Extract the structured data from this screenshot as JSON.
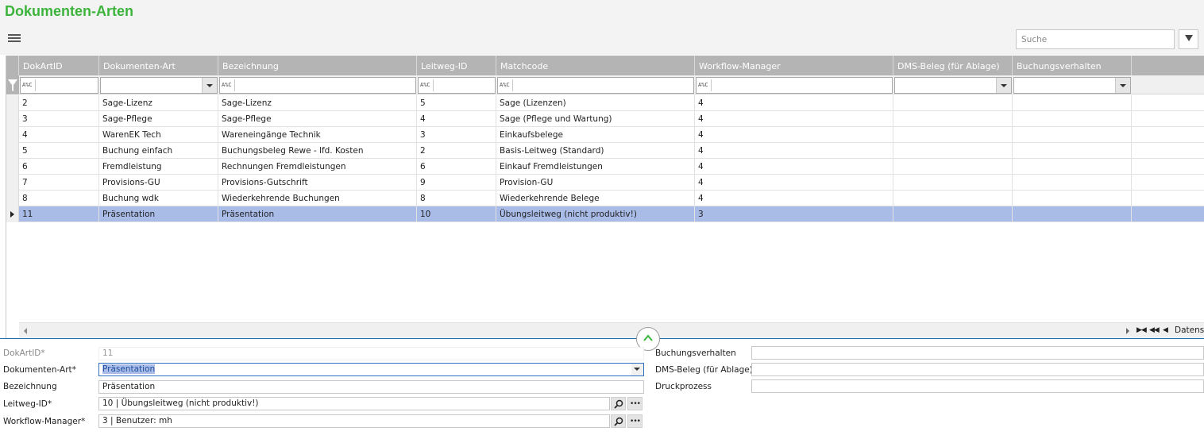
{
  "app": {
    "title": "Dokumenten-Arten"
  },
  "toolbar": {
    "search_placeholder": "Suche",
    "filter_toggle_icon": "triangle-down-icon"
  },
  "grid": {
    "columns": [
      "DokArtID",
      "Dokumenten-Art",
      "Bezeichnung",
      "Leitweg-ID",
      "Matchcode",
      "Workflow-Manager",
      "DMS-Beleg (für Ablage)",
      "Buchungsverhalten"
    ],
    "filter_operator_glyph": "A%C",
    "rows": [
      [
        "2",
        "Sage-Lizenz",
        "Sage-Lizenz",
        "5",
        "Sage (Lizenzen)",
        "4",
        "",
        ""
      ],
      [
        "3",
        "Sage-Pflege",
        "Sage-Pflege",
        "4",
        "Sage (Pflege und Wartung)",
        "4",
        "",
        ""
      ],
      [
        "4",
        "WarenEK Tech",
        "Wareneingänge Technik",
        "3",
        "Einkaufsbelege",
        "4",
        "",
        ""
      ],
      [
        "5",
        "Buchung einfach",
        "Buchungsbeleg Rewe - lfd. Kosten",
        "2",
        "Basis-Leitweg (Standard)",
        "4",
        "",
        ""
      ],
      [
        "6",
        "Fremdleistung",
        "Rechnungen Fremdleistungen",
        "6",
        "Einkauf Fremdleistungen",
        "4",
        "",
        ""
      ],
      [
        "7",
        "Provisions-GU",
        "Provisions-Gutschrift",
        "9",
        "Provision-GU",
        "4",
        "",
        ""
      ],
      [
        "8",
        "Buchung wdk",
        "Wiederkehrende Buchungen",
        "8",
        "Wiederkehrende Belege",
        "4",
        "",
        ""
      ],
      [
        "11",
        "Präsentation",
        "Präsentation",
        "10",
        "Übungsleitweg (nicht produktiv!)",
        "3",
        "",
        ""
      ]
    ],
    "selected_row": 7,
    "nav_label": "Datensa",
    "colors": {
      "header": "#b4b4b4",
      "selected_row": "#a9bbe7",
      "divider": "#1e6eb4"
    }
  },
  "form": {
    "left": [
      {
        "label": "DokArtID*",
        "value": "11"
      },
      {
        "label": "Dokumenten-Art*",
        "value": "Präsentation"
      },
      {
        "label": "Bezeichnung",
        "value": "Präsentation"
      },
      {
        "label": "Leitweg-ID*",
        "value": "10  |  Übungsleitweg (nicht produktiv!)"
      },
      {
        "label": "Workflow-Manager*",
        "value": "3  |  Benutzer: mh"
      }
    ],
    "right": [
      {
        "label": "Buchungsverhalten",
        "value": ""
      },
      {
        "label": "DMS-Beleg (für Ablage)",
        "value": ""
      },
      {
        "label": "Druckprozess",
        "value": ""
      }
    ],
    "more_glyph": "•••"
  },
  "brand_color": "#3cb43c"
}
